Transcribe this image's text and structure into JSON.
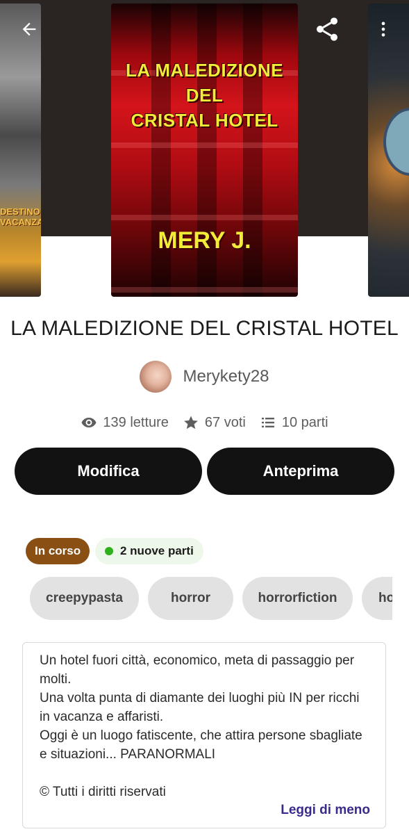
{
  "header": {
    "back_icon": "arrow-left-icon",
    "share_icon": "share-icon",
    "more_icon": "more-vertical-icon"
  },
  "covers": {
    "left_partial_text": "DESTINO\nVACANZA",
    "main": {
      "title_lines": [
        "LA MALEDIZIONE",
        "DEL",
        "CRISTAL HOTEL"
      ],
      "author": "MERY J."
    }
  },
  "book": {
    "title": "LA MALEDIZIONE DEL CRISTAL HOTEL",
    "author": "Merykety28"
  },
  "stats": {
    "reads_icon": "eye-icon",
    "reads": "139 letture",
    "votes_icon": "star-icon",
    "votes": "67 voti",
    "parts_icon": "list-icon",
    "parts": "10 parti"
  },
  "actions": {
    "edit_label": "Modifica",
    "preview_label": "Anteprima"
  },
  "status": {
    "badge": "In corso",
    "new_parts": "2 nuove parti",
    "new_parts_color": "#2fb11d",
    "badge_color": "#8a4f12"
  },
  "tags": [
    "creepypasta",
    "horror",
    "horrorfiction",
    "ho"
  ],
  "description": {
    "lines": [
      "Un hotel fuori città, economico, meta di passaggio per molti.",
      "Una volta punta di diamante dei luoghi più IN per ricchi in vacanza e affaristi.",
      "Oggi è un luogo fatiscente, che attira persone sbagliate e situazioni... PARANORMALI"
    ],
    "copyright": "© Tutti i diritti riservati",
    "read_less": "Leggi di meno",
    "link_color": "#3b2a8c"
  }
}
